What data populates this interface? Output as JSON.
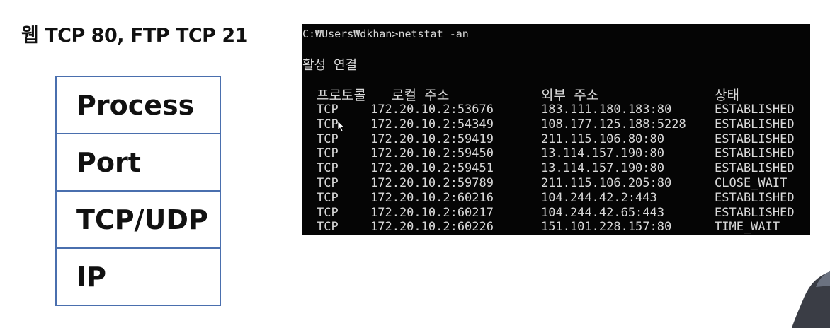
{
  "slide": {
    "title": "웹 TCP 80, FTP TCP 21"
  },
  "layers": [
    {
      "label": "Process"
    },
    {
      "label": "Port"
    },
    {
      "label": "TCP/UDP"
    },
    {
      "label": "IP"
    }
  ],
  "terminal": {
    "prompt": "C:₩Users₩dkhan>netstat -an",
    "section_title": "활성 연결",
    "headers": {
      "proto": "프로토콜",
      "local": "로컬 주소",
      "foreign": "외부 주소",
      "state": "상태"
    },
    "rows": [
      {
        "proto": "TCP",
        "local": "172.20.10.2:53676",
        "foreign": "183.111.180.183:80",
        "state": "ESTABLISHED"
      },
      {
        "proto": "TCP",
        "local": "172.20.10.2:54349",
        "foreign": "108.177.125.188:5228",
        "state": "ESTABLISHED"
      },
      {
        "proto": "TCP",
        "local": "172.20.10.2:59419",
        "foreign": "211.115.106.80:80",
        "state": "ESTABLISHED"
      },
      {
        "proto": "TCP",
        "local": "172.20.10.2:59450",
        "foreign": "13.114.157.190:80",
        "state": "ESTABLISHED"
      },
      {
        "proto": "TCP",
        "local": "172.20.10.2:59451",
        "foreign": "13.114.157.190:80",
        "state": "ESTABLISHED"
      },
      {
        "proto": "TCP",
        "local": "172.20.10.2:59789",
        "foreign": "211.115.106.205:80",
        "state": "CLOSE_WAIT"
      },
      {
        "proto": "TCP",
        "local": "172.20.10.2:60216",
        "foreign": "104.244.42.2:443",
        "state": "ESTABLISHED"
      },
      {
        "proto": "TCP",
        "local": "172.20.10.2:60217",
        "foreign": "104.244.42.65:443",
        "state": "ESTABLISHED"
      },
      {
        "proto": "TCP",
        "local": "172.20.10.2:60226",
        "foreign": "151.101.228.157:80",
        "state": "TIME_WAIT"
      }
    ]
  },
  "icons": {
    "cursor": "mouse-pointer-icon"
  },
  "colors": {
    "layer_border": "#4a6fae",
    "terminal_bg": "#050505",
    "terminal_text": "#d8d8d8"
  }
}
